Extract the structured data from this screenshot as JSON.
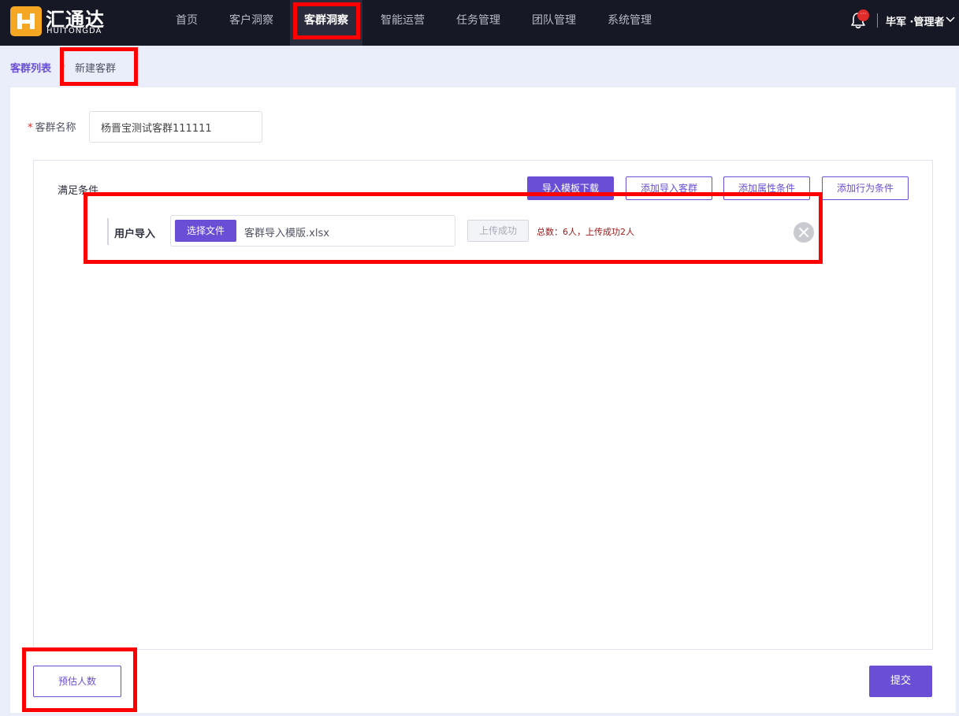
{
  "header": {
    "brand_cn": "汇通达",
    "brand_en": "HUITONGDA",
    "nav": [
      {
        "label": "首页"
      },
      {
        "label": "客户洞察"
      },
      {
        "label": "客群洞察"
      },
      {
        "label": "智能运营"
      },
      {
        "label": "任务管理"
      },
      {
        "label": "团队管理"
      },
      {
        "label": "系统管理"
      }
    ],
    "notification_badge": "···",
    "user": "毕军 ·管理者"
  },
  "breadcrumb": {
    "parent": "客群列表",
    "separator": "›",
    "current": "新建客群"
  },
  "form": {
    "required_mark": "*",
    "name_label": "客群名称",
    "name_value": "杨晋宝测试客群111111"
  },
  "conditions": {
    "title": "满足条件",
    "buttons": {
      "download_template": "导入模板下载",
      "add_import_group": "添加导入客群",
      "add_attribute": "添加属性条件",
      "add_behavior": "添加行为条件"
    },
    "import_row": {
      "label": "用户导入",
      "choose_file": "选择文件",
      "file_name": "客群导入模版.xlsx",
      "upload_button": "上传成功",
      "status": "总数：6人，上传成功2人"
    }
  },
  "footer": {
    "estimate": "预估人数",
    "submit": "提交"
  },
  "colors": {
    "accent": "#6a4fd6",
    "topbar": "#161826",
    "highlight": "#ff0000"
  }
}
